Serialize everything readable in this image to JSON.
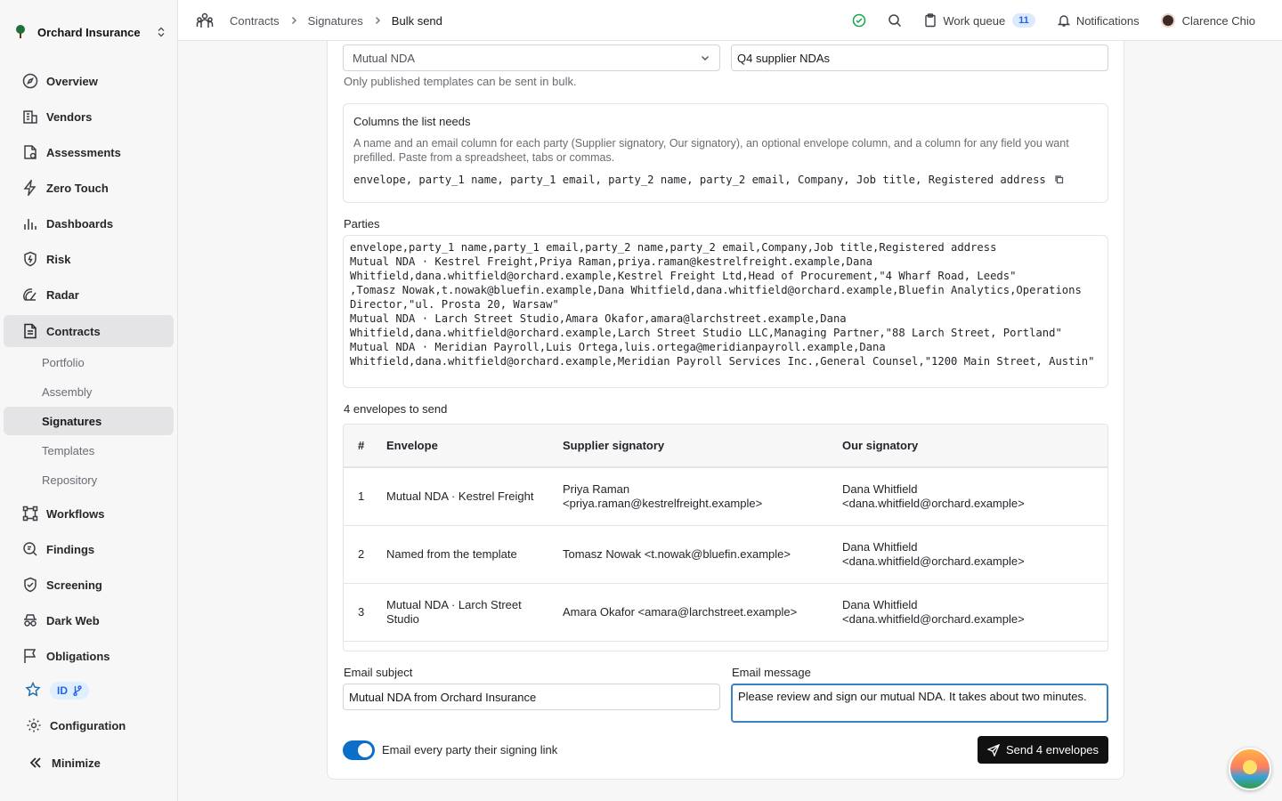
{
  "org": {
    "name": "Orchard Insurance"
  },
  "nav": {
    "items": [
      {
        "label": "Overview",
        "icon": "compass-icon"
      },
      {
        "label": "Vendors",
        "icon": "building-icon"
      },
      {
        "label": "Assessments",
        "icon": "file-check-icon"
      },
      {
        "label": "Zero Touch",
        "icon": "bolt-icon"
      },
      {
        "label": "Dashboards",
        "icon": "bar-chart-icon"
      },
      {
        "label": "Risk",
        "icon": "shield-icon"
      },
      {
        "label": "Radar",
        "icon": "radar-icon"
      },
      {
        "label": "Contracts",
        "icon": "document-icon"
      }
    ],
    "sub_items": [
      "Portfolio",
      "Assembly",
      "Signatures",
      "Templates",
      "Repository"
    ],
    "items_after": [
      {
        "label": "Workflows",
        "icon": "workflow-icon"
      },
      {
        "label": "Findings",
        "icon": "search-doc-icon"
      },
      {
        "label": "Screening",
        "icon": "shield-check-icon"
      },
      {
        "label": "Dark Web",
        "icon": "incognito-icon"
      },
      {
        "label": "Obligations",
        "icon": "flag-icon"
      }
    ],
    "id_label": "ID",
    "configuration": "Configuration",
    "minimize": "Minimize"
  },
  "breadcrumb": {
    "root": "Contracts",
    "middle": "Signatures",
    "current": "Bulk send"
  },
  "topbar": {
    "work_queue": "Work queue",
    "work_queue_count": "11",
    "notifications": "Notifications",
    "user": "Clarence Chio"
  },
  "form": {
    "template_value": "Mutual NDA",
    "batch_name": "Q4 supplier NDAs",
    "template_hint": "Only published templates can be sent in bulk.",
    "columns_title": "Columns the list needs",
    "columns_desc_1": "A name and an email column for each party (Supplier signatory, Our signatory), an optional envelope column, and a column for any field you want",
    "columns_desc_2": "prefilled. Paste from a spreadsheet, tabs or commas.",
    "columns_spec": "envelope, party_1 name, party_1 email, party_2 name, party_2 email, Company, Job title, Registered address",
    "parties_label": "Parties",
    "parties_text": "envelope,party_1 name,party_1 email,party_2 name,party_2 email,Company,Job title,Registered address\nMutual NDA · Kestrel Freight,Priya Raman,priya.raman@kestrelfreight.example,Dana\nWhitfield,dana.whitfield@orchard.example,Kestrel Freight Ltd,Head of Procurement,\"4 Wharf Road, Leeds\"\n,Tomasz Nowak,t.nowak@bluefin.example,Dana Whitfield,dana.whitfield@orchard.example,Bluefin Analytics,Operations\nDirector,\"ul. Prosta 20, Warsaw\"\nMutual NDA · Larch Street Studio,Amara Okafor,amara@larchstreet.example,Dana\nWhitfield,dana.whitfield@orchard.example,Larch Street Studio LLC,Managing Partner,\"88 Larch Street, Portland\"\nMutual NDA · Meridian Payroll,Luis Ortega,luis.ortega@meridianpayroll.example,Dana\nWhitfield,dana.whitfield@orchard.example,Meridian Payroll Services Inc.,General Counsel,\"1200 Main Street, Austin\"",
    "envelopes_count_label": "4 envelopes to send",
    "email_subject_label": "Email subject",
    "email_subject_value": "Mutual NDA from Orchard Insurance",
    "email_message_label": "Email message",
    "email_message_value": "Please review and sign our mutual NDA. It takes about two minutes.",
    "toggle_label": "Email every party their signing link",
    "toggle_on": true,
    "send_label": "Send 4 envelopes"
  },
  "table": {
    "headers": [
      "#",
      "Envelope",
      "Supplier signatory",
      "Our signatory"
    ],
    "rows": [
      {
        "num": "1",
        "envelope": "Mutual NDA · Kestrel Freight",
        "supplier": "Priya Raman <priya.raman@kestrelfreight.example>",
        "ours": "Dana Whitfield <dana.whitfield@orchard.example>"
      },
      {
        "num": "2",
        "envelope": "Named from the template",
        "supplier": "Tomasz Nowak <t.nowak@bluefin.example>",
        "ours": "Dana Whitfield <dana.whitfield@orchard.example>"
      },
      {
        "num": "3",
        "envelope": "Mutual NDA · Larch Street Studio",
        "supplier": "Amara Okafor <amara@larchstreet.example>",
        "ours": "Dana Whitfield <dana.whitfield@orchard.example>"
      }
    ]
  },
  "colors": {
    "accent": "#0b6fc9",
    "badge_bg": "#dbeafe",
    "primary_button": "#111111",
    "active_nav": "#e4e4e7"
  }
}
